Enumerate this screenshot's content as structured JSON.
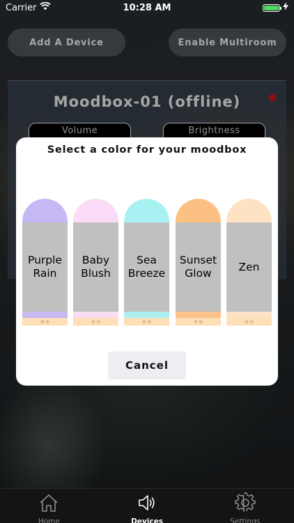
{
  "status_bar": {
    "carrier": "Carrier",
    "time": "10:28 AM",
    "battery_color": "#4cd964"
  },
  "header": {
    "add_device_label": "Add A Device",
    "multiroom_label": "Enable Multiroom"
  },
  "device": {
    "title": "Moodbox-01 (offline)",
    "status_color": "#e0141e",
    "volume_label": "Volume",
    "brightness_label": "Brightness"
  },
  "modal": {
    "title": "Select a color for your moodbox",
    "colors": [
      {
        "name": "Purple\nRain",
        "cap_color": "#c6b8f5",
        "stripe_color": "#c9b9f2"
      },
      {
        "name": "Baby\nBlush",
        "cap_color": "#fbdcf6",
        "stripe_color": "#fadcf3"
      },
      {
        "name": "Sea\nBreeze",
        "cap_color": "#a9f2f3",
        "stripe_color": "#aef0f2"
      },
      {
        "name": "Sunset\nGlow",
        "cap_color": "#fcc182",
        "stripe_color": "#fcc48a"
      },
      {
        "name": "Zen",
        "cap_color": "#fde2c4",
        "stripe_color": "#fde3c6"
      }
    ],
    "base_mark": "◎ ◎",
    "cancel_label": "Cancel"
  },
  "tab_bar": {
    "tabs": [
      {
        "label": "Home",
        "icon": "home-icon",
        "active": false
      },
      {
        "label": "Devices",
        "icon": "speaker-icon",
        "active": true
      },
      {
        "label": "Settings",
        "icon": "gear-icon",
        "active": false
      }
    ]
  }
}
